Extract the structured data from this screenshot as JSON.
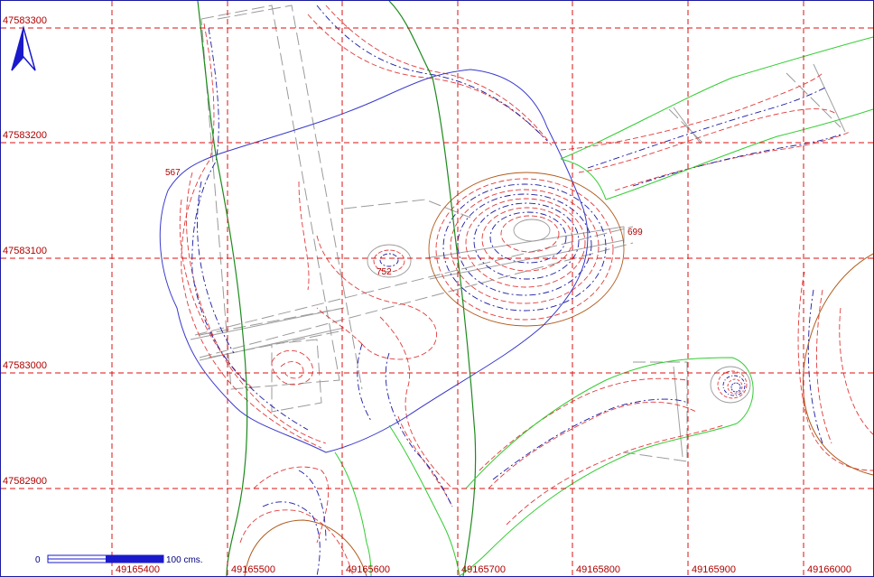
{
  "map": {
    "grid_x_labels": [
      "49165400",
      "49165500",
      "49165600",
      "49165700",
      "49165800",
      "49165900",
      "49166000"
    ],
    "grid_y_labels": [
      "47583300",
      "47583200",
      "47583100",
      "47583000",
      "47582900"
    ],
    "point_labels": {
      "p567": "567",
      "p752": "752",
      "p699": "699"
    },
    "scale_bar": {
      "start": "0",
      "end": "100 cms."
    },
    "north_arrow": "north-arrow-icon",
    "colors": {
      "grid": "#dd1111",
      "contour_red": "#e03a3a",
      "contour_blue": "#1a1aa0",
      "perimeter_blue": "#3a3acc",
      "river_green": "#1d8a1d",
      "road_green": "#33cc33",
      "structures": "#999999",
      "mound_brown": "#b05a1a",
      "labels": "#b00000"
    }
  }
}
